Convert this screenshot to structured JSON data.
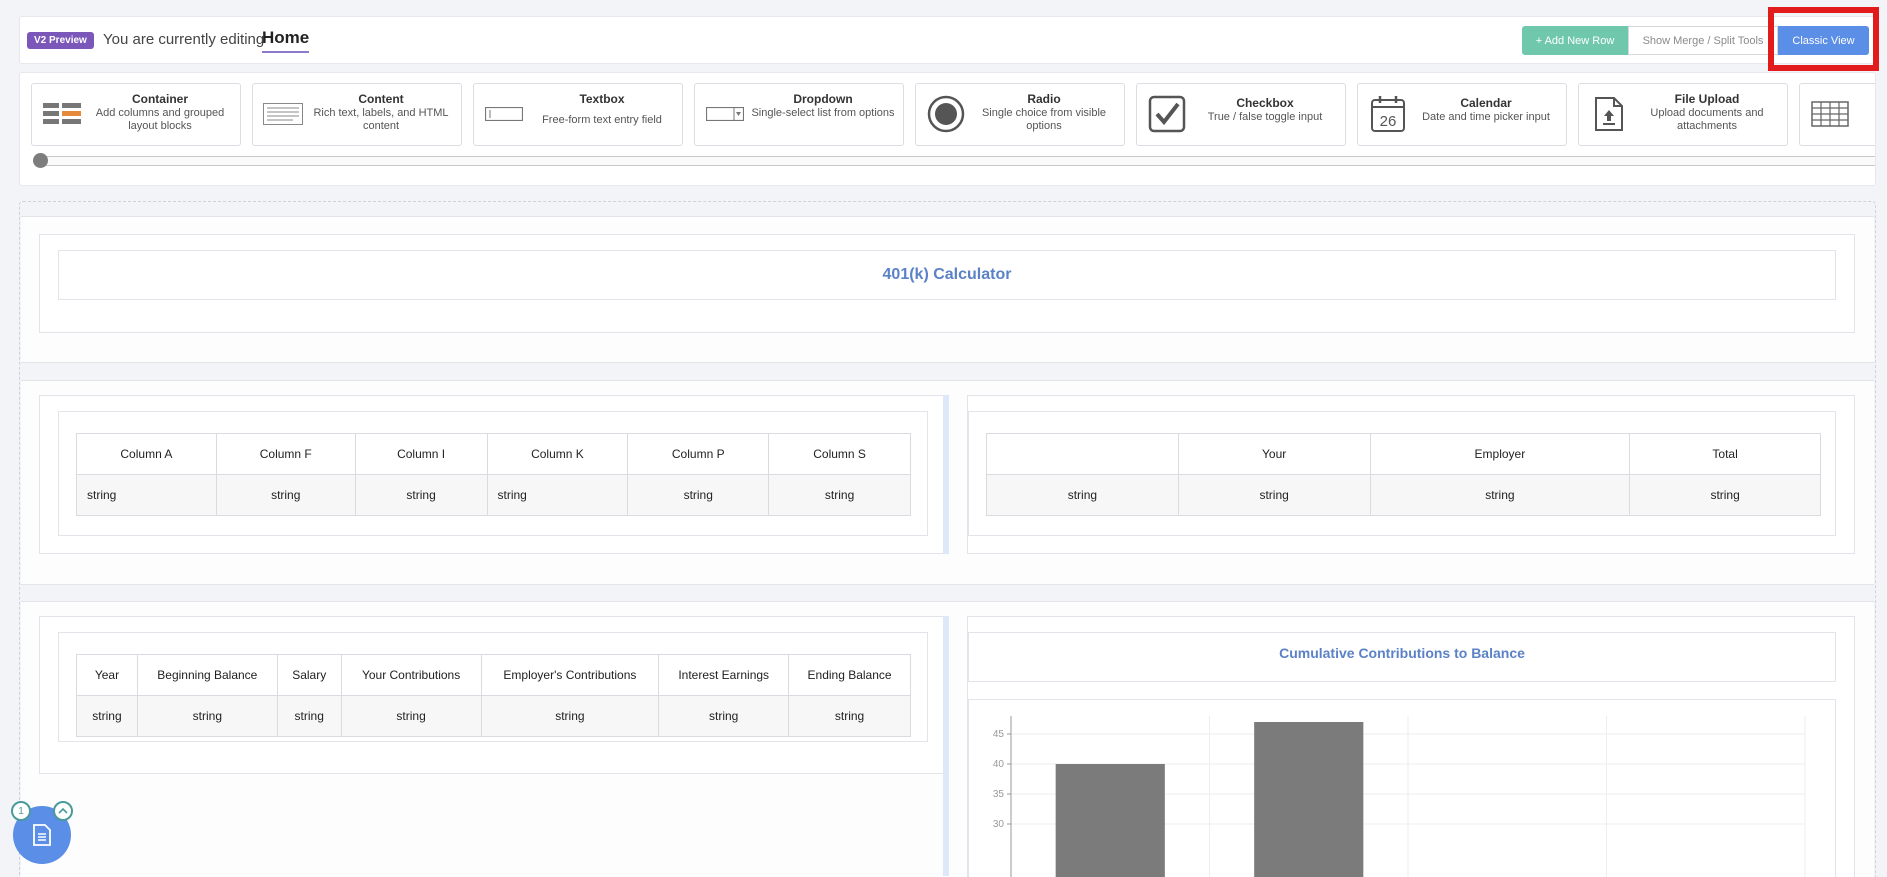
{
  "header": {
    "badge": "V2 Preview",
    "editing_label": "You are currently editing",
    "page_name": "Home",
    "add_row_label": "+ Add New Row",
    "merge_label": "Show Merge / Split Tools",
    "classic_label": "Classic View"
  },
  "toolbox": {
    "items": [
      {
        "name": "Container",
        "desc": "Add columns and grouped layout blocks",
        "icon": "container-icon"
      },
      {
        "name": "Content",
        "desc": "Rich text, labels, and HTML content",
        "icon": "content-icon"
      },
      {
        "name": "Textbox",
        "desc": "Free-form text entry field",
        "icon": "textbox-icon"
      },
      {
        "name": "Dropdown",
        "desc": "Single-select list from options",
        "icon": "dropdown-icon"
      },
      {
        "name": "Radio",
        "desc": "Single choice from visible options",
        "icon": "radio-icon"
      },
      {
        "name": "Checkbox",
        "desc": "True / false toggle input",
        "icon": "checkbox-icon"
      },
      {
        "name": "Calendar",
        "desc": "Date and time picker input",
        "icon": "calendar-icon",
        "icon_text": "26"
      },
      {
        "name": "File Upload",
        "desc": "Upload documents and attachments",
        "icon": "file-upload-icon"
      }
    ],
    "scroll_position": 0
  },
  "rows": {
    "title": "401(k) Calculator",
    "table1": {
      "headers": [
        "Column A",
        "Column F",
        "Column I",
        "Column K",
        "Column P",
        "Column S"
      ],
      "cells": [
        "string",
        "string",
        "string",
        "string",
        "string",
        "string"
      ]
    },
    "table2": {
      "headers": [
        "",
        "Your",
        "Employer",
        "Total"
      ],
      "cells": [
        "string",
        "string",
        "string",
        "string"
      ]
    },
    "table3": {
      "headers": [
        "Year",
        "Beginning Balance",
        "Salary",
        "Your Contributions",
        "Employer's Contributions",
        "Interest Earnings",
        "Ending Balance"
      ],
      "cells": [
        "string",
        "string",
        "string",
        "string",
        "string",
        "string",
        "string"
      ]
    },
    "chart_title": "Cumulative Contributions to Balance"
  },
  "chart_data": {
    "type": "bar",
    "title": "Cumulative Contributions to Balance",
    "categories": [
      "",
      "",
      "",
      ""
    ],
    "values": [
      40,
      47,
      null,
      null
    ],
    "ylim": [
      25,
      48
    ],
    "yticks": [
      "45",
      "40",
      "35",
      "30"
    ],
    "grid": true,
    "bar_color": "#7b7b7b"
  },
  "fab": {
    "badge": "1"
  },
  "colors": {
    "accent": "#5b8ee6",
    "success": "#6fc7ac",
    "badge": "#7b57b9",
    "title": "#5b82c6",
    "highlight": "#e21c1c"
  }
}
